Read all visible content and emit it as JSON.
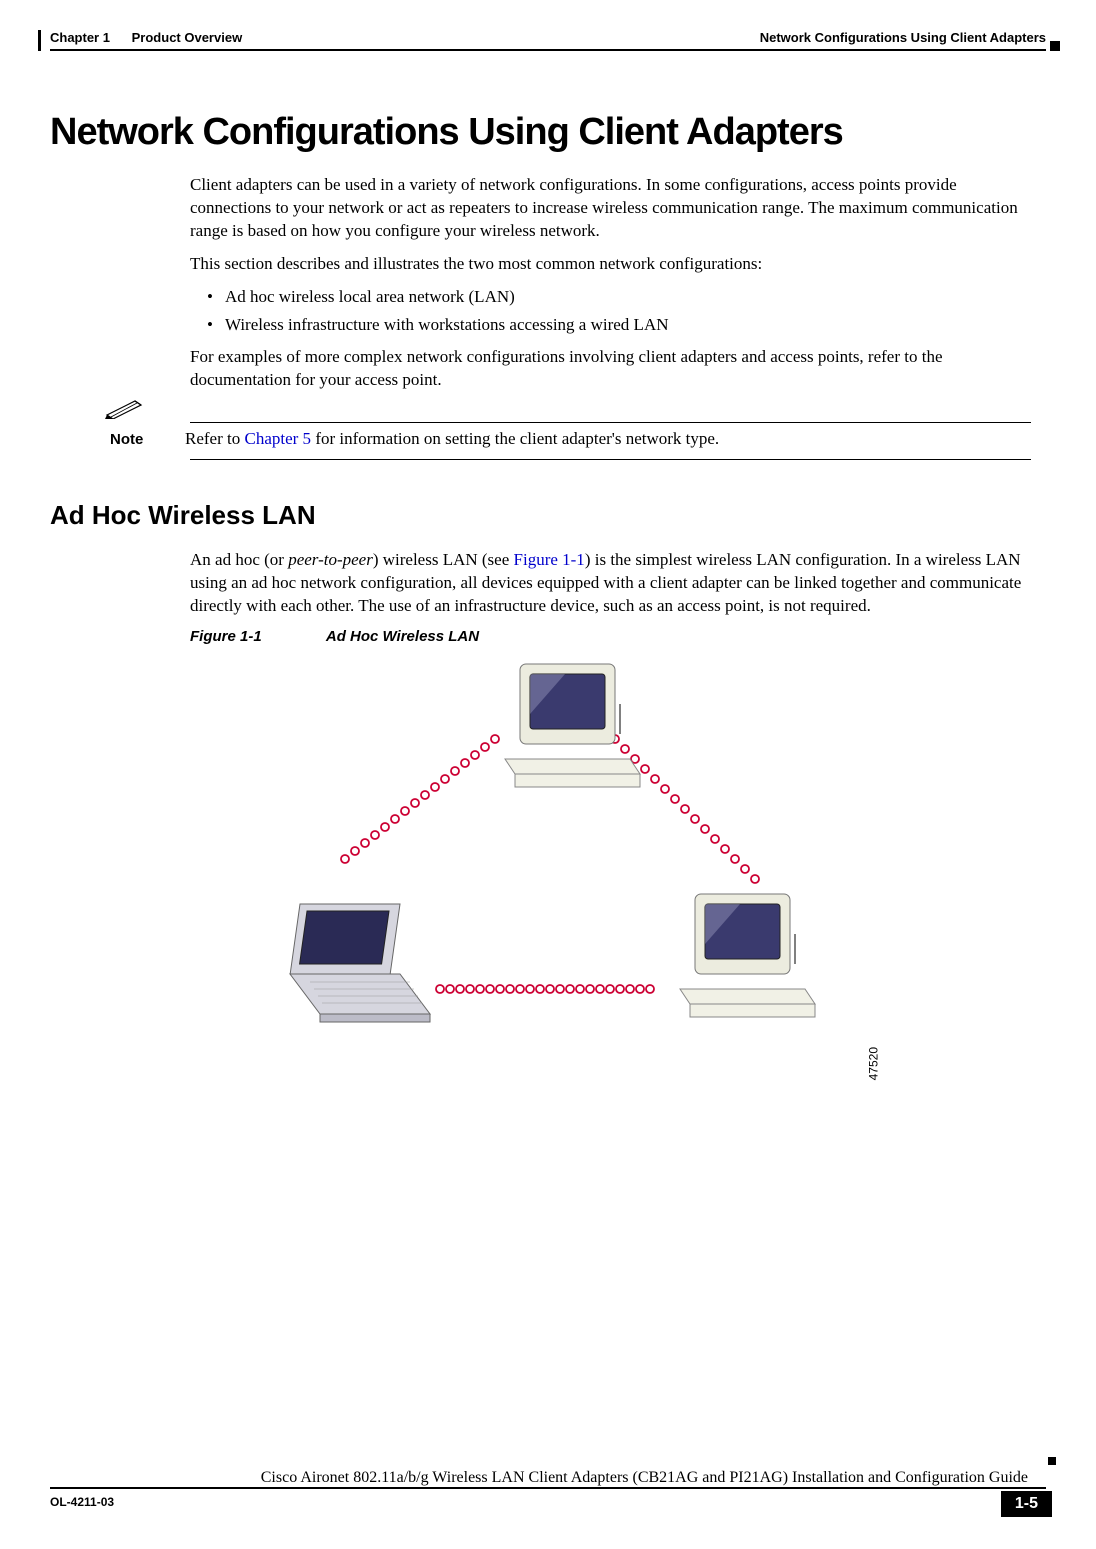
{
  "header": {
    "chapter": "Chapter 1",
    "chapter_title": "Product Overview",
    "section_right": "Network Configurations Using Client Adapters"
  },
  "title": "Network Configurations Using Client Adapters",
  "paragraphs": {
    "p1": "Client adapters can be used in a variety of network configurations. In some configurations, access points provide connections to your network or act as repeaters to increase wireless communication range. The maximum communication range is based on how you configure your wireless network.",
    "p2": "This section describes and illustrates the two most common network configurations:",
    "p3": "For examples of more complex network configurations involving client adapters and access points, refer to the documentation for your access point."
  },
  "bullets": {
    "b1": "Ad hoc wireless local area network (LAN)",
    "b2": "Wireless infrastructure with workstations accessing a wired LAN"
  },
  "note": {
    "label": "Note",
    "text_before_link": "Refer to ",
    "link": "Chapter 5",
    "text_after_link": " for information on setting the client adapter's network type."
  },
  "subsection": {
    "title": "Ad Hoc Wireless LAN",
    "p1_a": "An ad hoc (or ",
    "p1_italic": "peer-to-peer",
    "p1_b": ") wireless LAN (see ",
    "p1_link": "Figure 1-1",
    "p1_c": ") is the simplest wireless LAN configuration. In a wireless LAN using an ad hoc network configuration, all devices equipped with a client adapter can be linked together and communicate directly with each other. The use of an infrastructure device, such as an access point, is not required."
  },
  "figure": {
    "number": "Figure 1-1",
    "title": "Ad Hoc Wireless LAN",
    "image_id": "47520"
  },
  "footer": {
    "guide": "Cisco Aironet 802.11a/b/g Wireless LAN Client Adapters (CB21AG and PI21AG) Installation and Configuration Guide",
    "docnum": "OL-4211-03",
    "pagenum": "1-5"
  }
}
